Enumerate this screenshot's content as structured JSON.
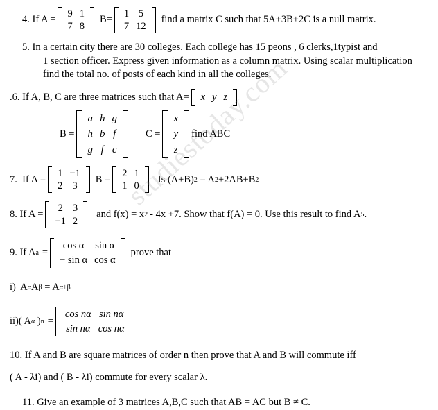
{
  "watermark": "studiestoday.com",
  "questions": {
    "q4": {
      "number": "4. If A =",
      "a": [
        [
          "9",
          "1"
        ],
        [
          "7",
          "8"
        ]
      ],
      "b_label": "B=",
      "b": [
        [
          "1",
          "5"
        ],
        [
          "7",
          "12"
        ]
      ],
      "tail": "find a matrix C such that 5A+3B+2C is a null matrix."
    },
    "q5": {
      "line1": "5. In a certain city there are 30 colleges. Each college has 15 peons , 6 clerks,1typist and",
      "line2": "1 section officer. Express given information as a column matrix. Using scalar multiplication",
      "line3": "find the total no. of posts of each kind in all the colleges."
    },
    "q6": {
      "lead": ".6. If A, B, C are three matrices such that A=",
      "a_row": [
        "x",
        "y",
        "z"
      ],
      "b_label": "B =",
      "b": [
        [
          "a",
          "h",
          "g"
        ],
        [
          "h",
          "b",
          "f"
        ],
        [
          "g",
          "f",
          "c"
        ]
      ],
      "c_label": "C =",
      "c": [
        [
          "x"
        ],
        [
          "y"
        ],
        [
          "z"
        ]
      ],
      "tail": "find ABC"
    },
    "q7": {
      "number": "7.  If A =",
      "a": [
        [
          "1",
          "−1"
        ],
        [
          "2",
          "3"
        ]
      ],
      "b_label": "B =",
      "b": [
        [
          "2",
          "1"
        ],
        [
          "1",
          "0"
        ]
      ],
      "tail_pre": "Is (A+B)",
      "tail_sup1": "2",
      "tail_mid": " = A",
      "tail_sup2": "2",
      "tail_mid2": "+2AB+B",
      "tail_sup3": "2"
    },
    "q8": {
      "number": "8. If A =",
      "a": [
        [
          "2",
          "3"
        ],
        [
          "−1",
          "2"
        ]
      ],
      "tail_pre": "and f(x) = x",
      "tail_sup1": "2",
      "tail_mid": "- 4x +7. Show that f(A) = 0. Use this result to find A",
      "tail_sup2": "5",
      "tail_end": "."
    },
    "q9": {
      "number": "9. If A",
      "number_sub": "a",
      "equals": "=",
      "a": [
        [
          "cos α",
          "sin α"
        ],
        [
          "− sin α",
          "cos α"
        ]
      ],
      "tail": "prove that"
    },
    "q9i": {
      "pre": "i)  A",
      "sub1": "α",
      "mid": "A",
      "sub2": "β",
      "eq": " = A",
      "sub3": "α+β"
    },
    "q9ii": {
      "pre": "ii)( A",
      "sub1": "α",
      "mid": " )",
      "sup1": "n",
      "eq": "=",
      "m": [
        [
          "cos nα",
          "sin nα"
        ],
        [
          "sin nα",
          "cos nα"
        ]
      ]
    },
    "q10": {
      "line1": "10.  If A and B are square matrices of order  n then prove that A and B will commute iff",
      "line2": "( A - λi) and ( B - λi) commute for every scalar λ."
    },
    "q11": {
      "line1": "11. Give an example of 3 matrices A,B,C such that AB = AC but B ≠ C."
    }
  }
}
